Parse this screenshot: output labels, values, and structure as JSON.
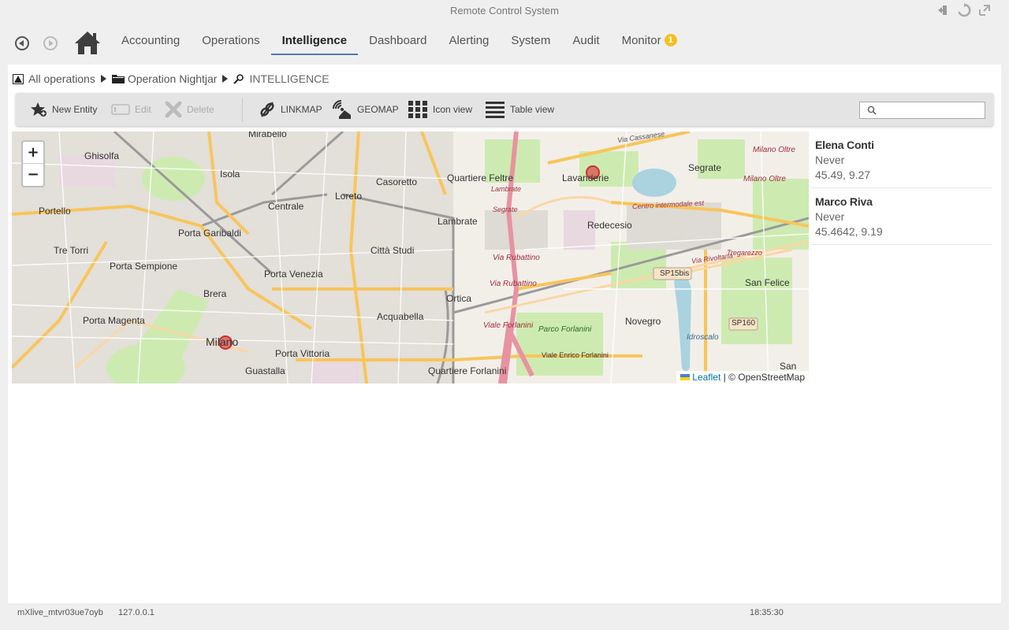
{
  "window": {
    "title": "Remote Control System"
  },
  "nav": {
    "tabs": [
      {
        "label": "Accounting"
      },
      {
        "label": "Operations"
      },
      {
        "label": "Intelligence",
        "active": true
      },
      {
        "label": "Dashboard"
      },
      {
        "label": "Alerting"
      },
      {
        "label": "System"
      },
      {
        "label": "Audit"
      },
      {
        "label": "Monitor",
        "badge": "1"
      }
    ]
  },
  "breadcrumb": {
    "root": "All operations",
    "operation": "Operation Nightjar",
    "section": "INTELLIGENCE"
  },
  "toolbar": {
    "new_entity": "New Entity",
    "edit": "Edit",
    "delete": "Delete",
    "linkmap": "LINKMAP",
    "geomap": "GEOMAP",
    "icon_view": "Icon view",
    "table_view": "Table view",
    "search_value": ""
  },
  "map": {
    "zoom_in": "+",
    "zoom_out": "−",
    "attribution_leaflet": "Leaflet",
    "attribution_rest": "| © OpenStreetMap",
    "labels": {
      "mirabello": "Mirabello",
      "viacassanese": "Via Cassanese",
      "milanooltre1": "Milano Oltre",
      "ghisolfa": "Ghisolfa",
      "isola": "Isola",
      "casoretto": "Casoretto",
      "quartierefeltre": "Quartiere Feltre",
      "lavanderie": "Lavanderie",
      "segrate": "Segrate",
      "milanooltre2": "Milano Oltre",
      "portello": "Portello",
      "centrale": "Centrale",
      "loreto": "Loreto",
      "lambrate_st": "Lambrate",
      "segrate_st": "Segrate",
      "centrointermodale": "Centro intermodale est",
      "portagaribaldi": "Porta Garibaldi",
      "lambrate": "Lambrate",
      "redecesio": "Redecesio",
      "tretorri": "Tre Torri",
      "cittastudi": "Città Studi",
      "tregarezzo": "Tregarezzo",
      "viarubattino1": "Via Rubattino",
      "viarivoltana": "Via Rivoltana",
      "portasempione": "Porta Sempione",
      "portavenezia": "Porta Venezia",
      "sp15bis": "SP15bis",
      "sanfelice": "San Felice",
      "viarubattino2": "Via Rubattino",
      "brera": "Brera",
      "ortica": "Ortica",
      "acquabella": "Acquabella",
      "portamagenta": "Porta Magenta",
      "novegro": "Novegro",
      "sp160": "SP160",
      "vialeforlanini": "Viale Forlanini",
      "parcoforlanini": "Parco Forlanini",
      "idroscalo": "Idroscalo",
      "milano": "Milano",
      "portavittoria": "Porta Vittoria",
      "vialeenricoforlanini": "Viale Enrico Forlanini",
      "guastalla": "Guastalla",
      "quartiereforlanini": "Quartiere Forlanini",
      "sanbo": "San Bo"
    }
  },
  "entities": [
    {
      "name": "Elena Conti",
      "last_seen": "Never",
      "coords": "45.49, 9.27"
    },
    {
      "name": "Marco Riva",
      "last_seen": "Never",
      "coords": "45.4642, 9.19"
    }
  ],
  "status": {
    "instance": "mXlive_mtvr03ue7oyb",
    "ip": "127.0.0.1",
    "time": "18:35:30"
  }
}
